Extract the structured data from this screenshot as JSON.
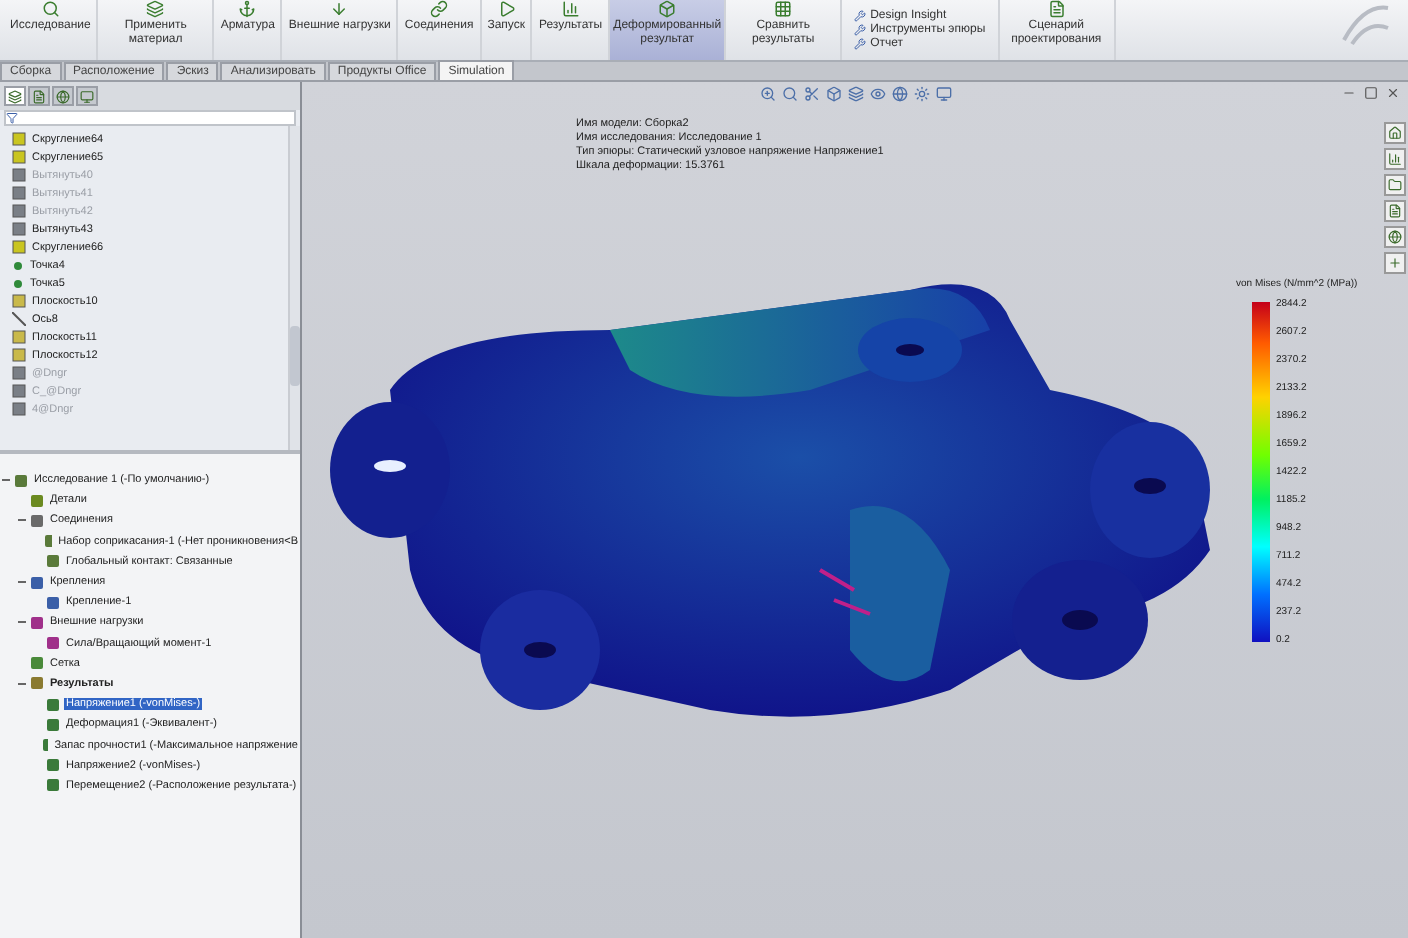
{
  "ribbon": {
    "buttons": [
      {
        "label": "Исследование",
        "selected": false,
        "kind": "study"
      },
      {
        "label": "Применить материал",
        "selected": false,
        "kind": "material"
      },
      {
        "label": "Арматура",
        "selected": false,
        "kind": "fixture"
      },
      {
        "label": "Внешние нагрузки",
        "selected": false,
        "kind": "load"
      },
      {
        "label": "Соединения",
        "selected": false,
        "kind": "connection"
      },
      {
        "label": "Запуск",
        "selected": false,
        "kind": "run"
      },
      {
        "label": "Результаты",
        "selected": false,
        "kind": "results"
      },
      {
        "label": "Деформированный результат",
        "selected": true,
        "kind": "deformed"
      },
      {
        "label": "Сравнить результаты",
        "selected": false,
        "kind": "compare"
      }
    ],
    "small_items": [
      "Design Insight",
      "Инструменты эпюры",
      "Отчет"
    ],
    "scenario": "Сценарий проектирования"
  },
  "tabs": [
    {
      "label": "Сборка",
      "selected": false
    },
    {
      "label": "Расположение",
      "selected": false
    },
    {
      "label": "Эскиз",
      "selected": false
    },
    {
      "label": "Анализировать",
      "selected": false
    },
    {
      "label": "Продукты Office",
      "selected": false
    },
    {
      "label": "Simulation",
      "selected": true
    }
  ],
  "feature_tree": {
    "items": [
      {
        "label": "Скругление64",
        "kind": "fillet",
        "suppressed": false
      },
      {
        "label": "Скругление65",
        "kind": "fillet",
        "suppressed": false
      },
      {
        "label": "Вытянуть40",
        "kind": "extrude",
        "suppressed": true
      },
      {
        "label": "Вытянуть41",
        "kind": "extrude",
        "suppressed": true
      },
      {
        "label": "Вытянуть42",
        "kind": "extrude",
        "suppressed": true
      },
      {
        "label": "Вытянуть43",
        "kind": "extrude",
        "suppressed": false
      },
      {
        "label": "Скругление66",
        "kind": "fillet",
        "suppressed": false
      },
      {
        "label": "Точка4",
        "kind": "point",
        "suppressed": false
      },
      {
        "label": "Точка5",
        "kind": "point",
        "suppressed": false
      },
      {
        "label": "Плоскость10",
        "kind": "plane",
        "suppressed": false
      },
      {
        "label": "Ось8",
        "kind": "axis",
        "suppressed": false
      },
      {
        "label": "Плоскость11",
        "kind": "plane",
        "suppressed": false
      },
      {
        "label": "Плоскость12",
        "kind": "plane",
        "suppressed": false
      },
      {
        "label": "@Dngr",
        "kind": "extrude",
        "suppressed": true
      },
      {
        "label": "C_@Dngr",
        "kind": "extrude",
        "suppressed": true
      },
      {
        "label": "4@Dngr",
        "kind": "extrude",
        "suppressed": true
      }
    ]
  },
  "study_tree": {
    "items": [
      {
        "label": "Исследование 1 (-По умолчанию-)",
        "kind": "study",
        "bold": false,
        "selected": false,
        "children": [
          {
            "label": "Детали",
            "kind": "parts",
            "bold": false,
            "selected": false
          },
          {
            "label": "Соединения",
            "kind": "connection",
            "bold": false,
            "selected": false,
            "children": [
              {
                "label": "Набор соприкасания-1 (-Нет проникновения<В",
                "kind": "contact",
                "bold": false,
                "selected": false
              },
              {
                "label": "Глобальный контакт: Связанные",
                "kind": "contact",
                "bold": false,
                "selected": false
              }
            ]
          },
          {
            "label": "Крепления",
            "kind": "fixture",
            "bold": false,
            "selected": false,
            "children": [
              {
                "label": "Крепление-1",
                "kind": "fixture",
                "bold": false,
                "selected": false
              }
            ]
          },
          {
            "label": "Внешние нагрузки",
            "kind": "load",
            "bold": false,
            "selected": false,
            "children": [
              {
                "label": "Сила/Вращающий момент-1",
                "kind": "load",
                "bold": false,
                "selected": false
              }
            ]
          },
          {
            "label": "Сетка",
            "kind": "mesh",
            "bold": false,
            "selected": false
          },
          {
            "label": "Результаты",
            "kind": "results",
            "bold": true,
            "selected": false,
            "children": [
              {
                "label": "Напряжение1 (-vonMises-)",
                "kind": "plot",
                "bold": false,
                "selected": true
              },
              {
                "label": "Деформация1 (-Эквивалент-)",
                "kind": "plot",
                "bold": false,
                "selected": false
              },
              {
                "label": "Запас прочности1 (-Максимальное напряжение",
                "kind": "plot",
                "bold": false,
                "selected": false
              },
              {
                "label": "Напряжение2 (-vonMises-)",
                "kind": "plot",
                "bold": false,
                "selected": false
              },
              {
                "label": "Перемещение2 (-Расположение результата-)",
                "kind": "plot",
                "bold": false,
                "selected": false
              }
            ]
          }
        ]
      }
    ]
  },
  "viewport": {
    "info": [
      "Имя модели: Сборка2",
      "Имя исследования: Исследование 1",
      "Тип эпюры: Статический узловое напряжение Напряжение1",
      "Шкала деформации: 15.3761"
    ],
    "legend": {
      "title": "von Mises (N/mm^2 (MPa))",
      "ticks": [
        "2844.2",
        "2607.2",
        "2370.2",
        "2133.2",
        "1896.2",
        "1659.2",
        "1422.2",
        "1185.2",
        "948.2",
        "711.2",
        "474.2",
        "237.2",
        "0.2"
      ]
    }
  }
}
